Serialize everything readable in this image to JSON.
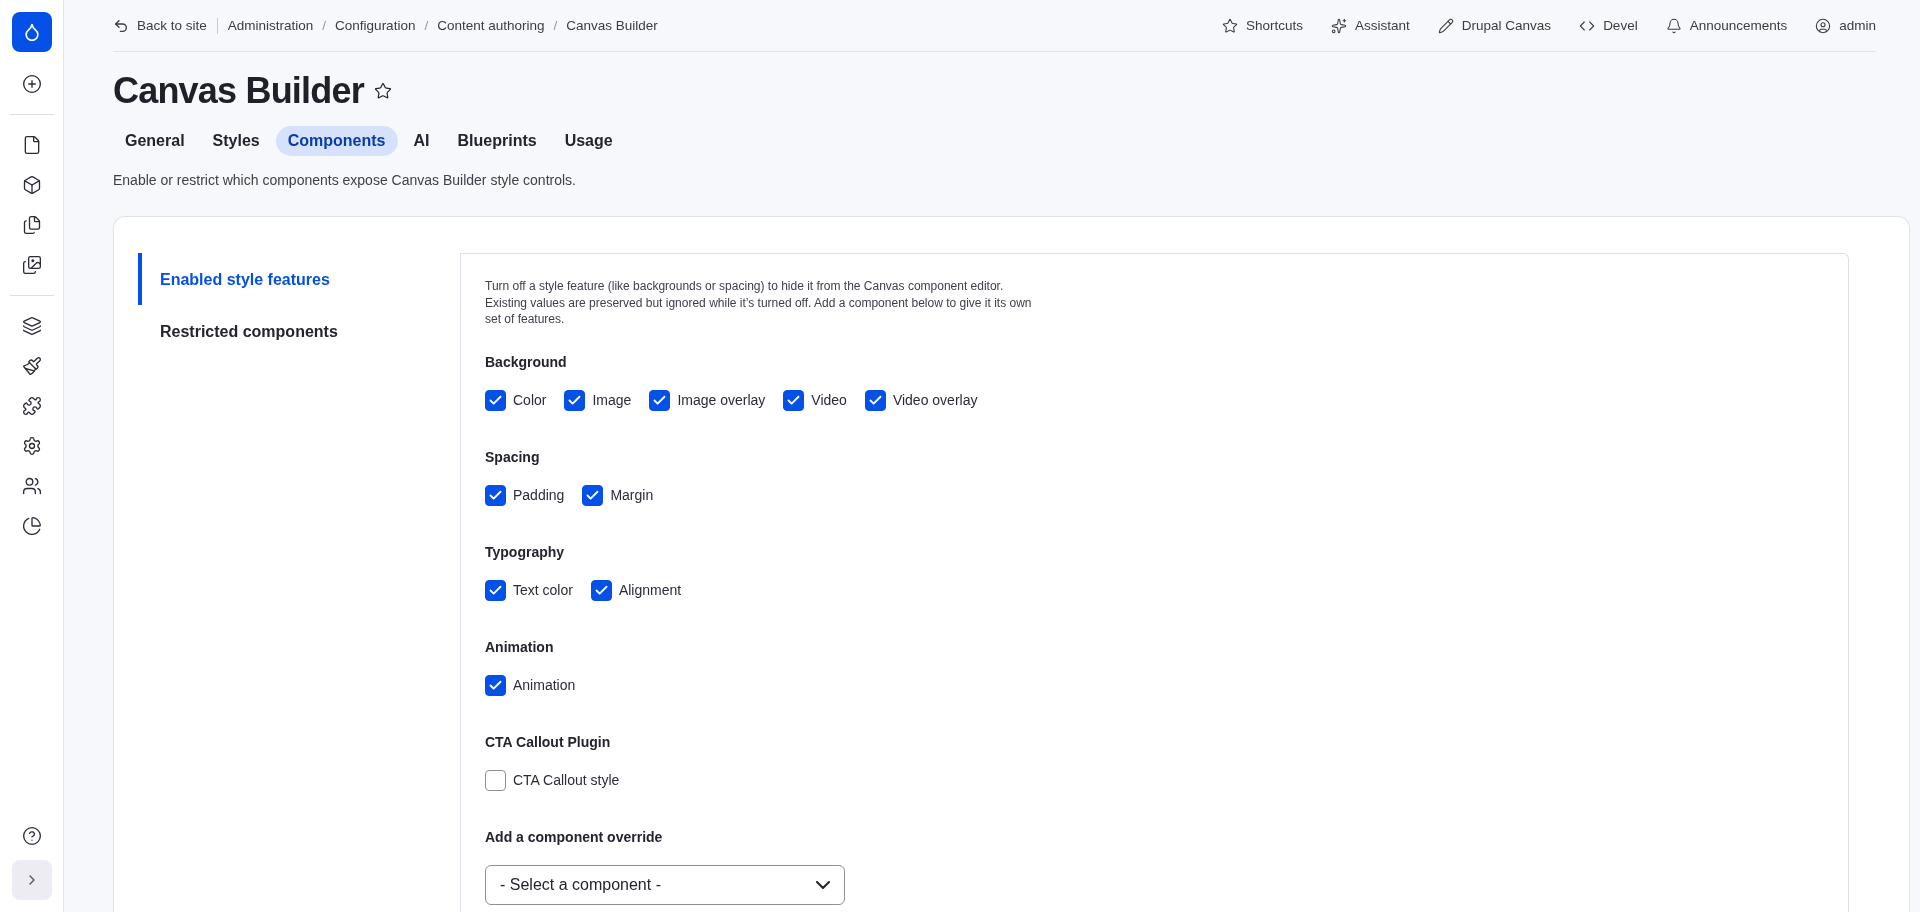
{
  "topbar": {
    "back": "Back to site",
    "breadcrumb": [
      {
        "label": "Administration"
      },
      {
        "separator": "/",
        "label": "Configuration"
      },
      {
        "separator": "/",
        "label": "Content authoring"
      },
      {
        "separator": "/",
        "label": "Canvas Builder"
      }
    ],
    "actions": [
      {
        "label": "Shortcuts"
      },
      {
        "label": "Assistant"
      },
      {
        "label": "Drupal Canvas"
      },
      {
        "label": "Devel"
      },
      {
        "label": "Announcements"
      },
      {
        "label": "admin"
      }
    ]
  },
  "page": {
    "title": "Canvas Builder",
    "description": "Enable or restrict which components expose Canvas Builder style controls."
  },
  "tabs": [
    {
      "label": "General",
      "selected": false
    },
    {
      "label": "Styles",
      "selected": false
    },
    {
      "label": "Components",
      "selected": true
    },
    {
      "label": "AI",
      "selected": false
    },
    {
      "label": "Blueprints",
      "selected": false
    },
    {
      "label": "Usage",
      "selected": false
    }
  ],
  "vertical_tabs": [
    {
      "label": "Enabled style features",
      "selected": true
    },
    {
      "label": "Restricted components",
      "selected": false
    }
  ],
  "intro": "Turn off a style feature (like backgrounds or spacing) to hide it from the Canvas component editor. Existing values are preserved but ignored while it’s turned off. Add a component below to give it its own set of features.",
  "groups": [
    {
      "title": "Background",
      "options": [
        {
          "label": "Color",
          "checked": true
        },
        {
          "label": "Image",
          "checked": true
        },
        {
          "label": "Image overlay",
          "checked": true
        },
        {
          "label": "Video",
          "checked": true
        },
        {
          "label": "Video overlay",
          "checked": true
        }
      ]
    },
    {
      "title": "Spacing",
      "options": [
        {
          "label": "Padding",
          "checked": true
        },
        {
          "label": "Margin",
          "checked": true
        }
      ]
    },
    {
      "title": "Typography",
      "options": [
        {
          "label": "Text color",
          "checked": true
        },
        {
          "label": "Alignment",
          "checked": true
        }
      ]
    },
    {
      "title": "Animation",
      "options": [
        {
          "label": "Animation",
          "checked": true
        }
      ]
    },
    {
      "title": "CTA Callout Plugin",
      "options": [
        {
          "label": "CTA Callout style",
          "checked": false
        }
      ]
    }
  ],
  "override": {
    "label": "Add a component override",
    "value": "- Select a component -"
  }
}
